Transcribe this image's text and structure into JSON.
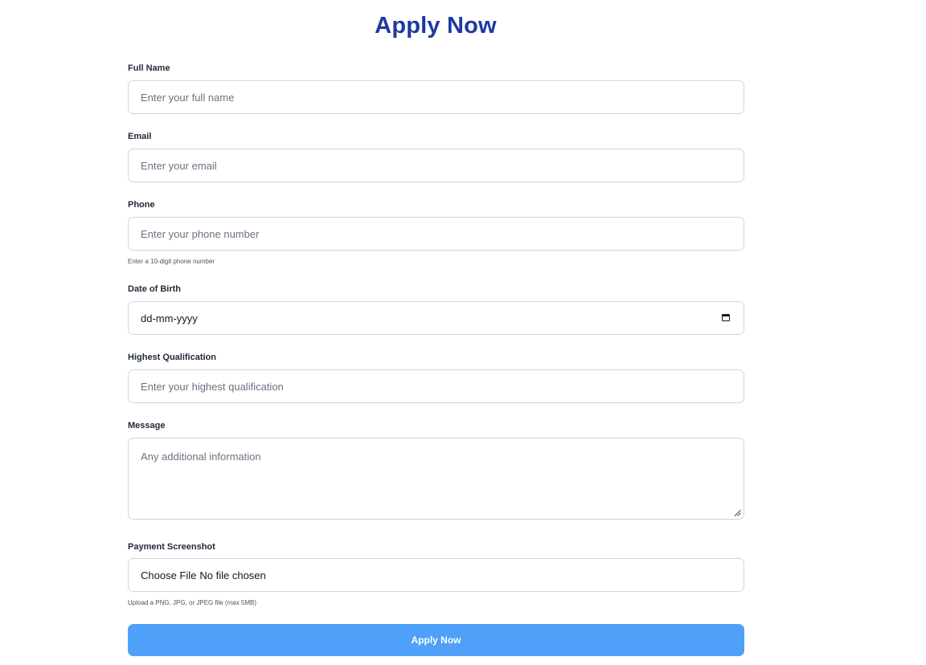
{
  "title": "Apply Now",
  "form": {
    "full_name": {
      "label": "Full Name",
      "placeholder": "Enter your full name"
    },
    "email": {
      "label": "Email",
      "placeholder": "Enter your email"
    },
    "phone": {
      "label": "Phone",
      "placeholder": "Enter your phone number",
      "hint": "Enter a 10-digit phone number"
    },
    "dob": {
      "label": "Date of Birth",
      "value": "dd-mm-yyyy",
      "icon": "calendar-icon"
    },
    "qualification": {
      "label": "Highest Qualification",
      "placeholder": "Enter your highest qualification"
    },
    "message": {
      "label": "Message",
      "placeholder": "Any additional information",
      "icon": "resize-handle-icon"
    },
    "payment": {
      "label": "Payment Screenshot",
      "button_label": "Choose File",
      "status": "No file chosen",
      "hint": "Upload a PNG, JPG, or JPEG file (max 5MB)"
    },
    "submit_label": "Apply Now"
  },
  "colors": {
    "title": "#1e3a9f",
    "submit_bg": "#4fa0f8",
    "border": "#d1d5db"
  }
}
